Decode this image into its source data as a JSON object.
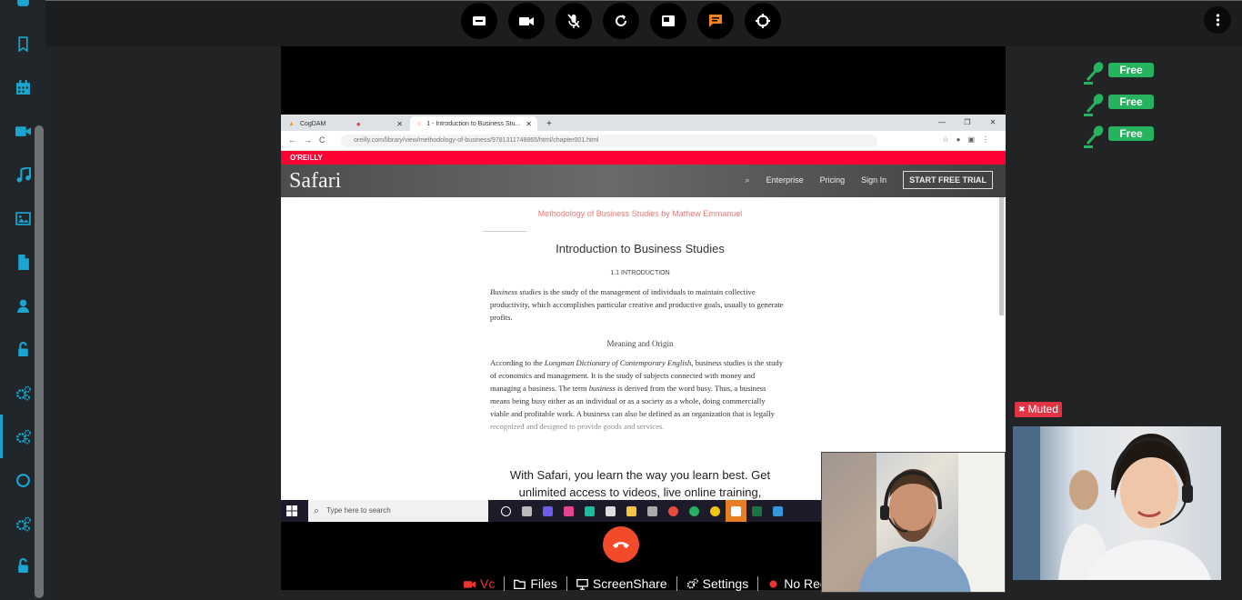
{
  "sidebar": {
    "items": [
      {
        "name": "bookmark-icon"
      },
      {
        "name": "calendar-icon"
      },
      {
        "name": "video-icon"
      },
      {
        "name": "music-icon"
      },
      {
        "name": "image-icon"
      },
      {
        "name": "file-icon"
      },
      {
        "name": "user-icon"
      },
      {
        "name": "unlock-icon"
      },
      {
        "name": "gears-icon"
      },
      {
        "name": "gears-icon-active"
      },
      {
        "name": "circle-icon"
      },
      {
        "name": "gears-icon"
      },
      {
        "name": "unlock-icon"
      }
    ],
    "accent": "#17a2c8"
  },
  "topbar": {
    "buttons": [
      "whiteboard-icon",
      "camera-icon",
      "mic-off-icon",
      "refresh-icon",
      "screen-icon",
      "chat-icon",
      "target-icon"
    ],
    "chat_color": "#f5821f"
  },
  "browser": {
    "tab1": "CogDAM",
    "tab2": "1 - Introduction to Business Stu...",
    "url": "oreilly.com/library/view/methodology-of-business/9781311748865/html/chapter001.html",
    "brand_strip": "O'REILLY",
    "logo": "Safari",
    "nav": [
      "Enterprise",
      "Pricing",
      "Sign In"
    ],
    "trial": "START FREE TRIAL"
  },
  "doc": {
    "book_title": "Methodology of Business Studies by Mathew Emmanuel",
    "chapter": "Introduction to Business Studies",
    "section": "1.1 INTRODUCTION",
    "p1_em": "Business studies",
    "p1": " is the study of the management of individuals to maintain collective productivity, which accomplishes particular creative and productive goals, usually to generate profits.",
    "subhead": "Meaning and Origin",
    "p2_a": "According to the ",
    "p2_em": "Longman Dictionary of Contemporary English",
    "p2_b": ", business studies is the study of economics and management. It is the study of subjects connected with money and managing a business. The term ",
    "p2_em2": "business",
    "p2_c": " is derived from the word busy. Thus, a business means being busy either as an individual or as a society as a whole, doing commercially viable and profitable work. A business can also be defined as an organization that is legally recognized and designed to provide goods and services.",
    "promo_1": "With Safari, you learn the way you learn best. Get",
    "promo_2": "unlimited access to videos, live online training,"
  },
  "taskbar": {
    "search": "Type here to search"
  },
  "controls": {
    "vc": "Vc",
    "files": "Files",
    "screenshare": "ScreenShare",
    "settings": "Settings",
    "record": "No Reco"
  },
  "seats": [
    "Free",
    "Free",
    "Free"
  ],
  "participant": {
    "muted_label": "Muted"
  }
}
